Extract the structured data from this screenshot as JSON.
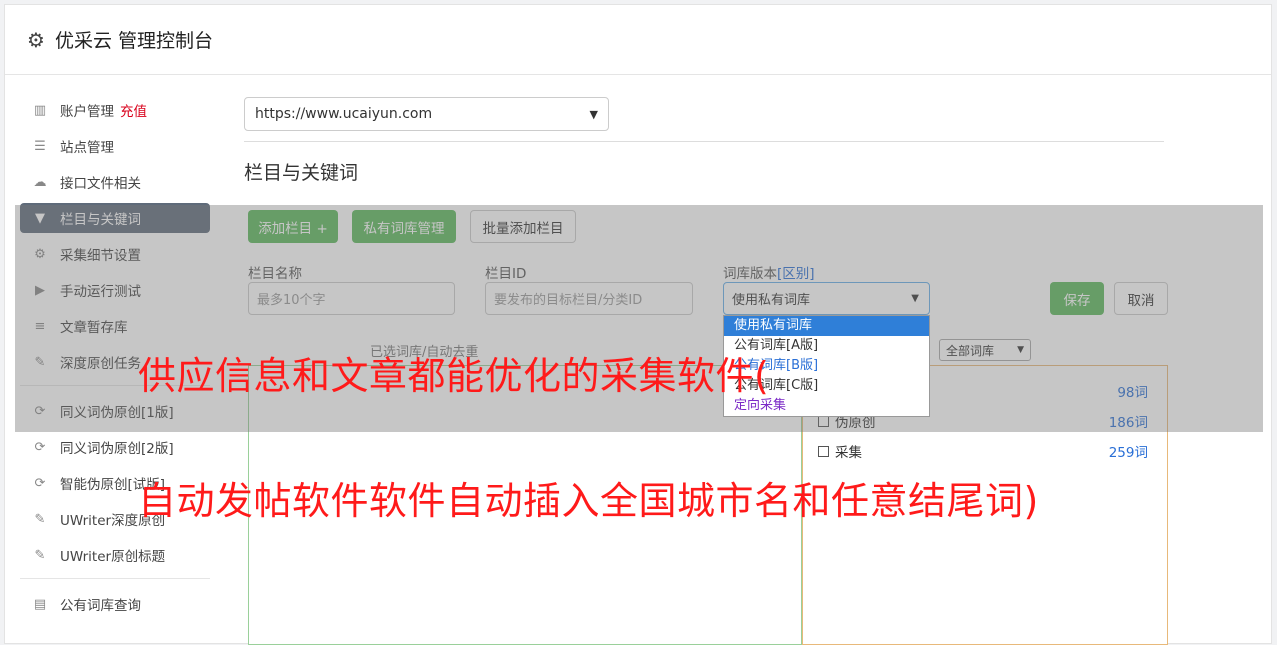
{
  "app": {
    "title": "优采云 管理控制台",
    "icon": "gear-icon"
  },
  "sidebar": {
    "items": [
      {
        "label": "账户管理",
        "icon": "bar-chart-icon",
        "extra": "充值"
      },
      {
        "label": "站点管理",
        "icon": "server-icon"
      },
      {
        "label": "接口文件相关",
        "icon": "cloud-upload-icon"
      },
      {
        "label": "栏目与关键词",
        "icon": "filter-icon",
        "active": true
      },
      {
        "label": "采集细节设置",
        "icon": "gears-icon"
      },
      {
        "label": "手动运行测试",
        "icon": "play-circle-icon"
      },
      {
        "label": "文章暂存库",
        "icon": "database-icon"
      },
      {
        "label": "深度原创任务",
        "icon": "edit-icon"
      },
      {
        "label": "同义词伪原创[1版]",
        "icon": "refresh-icon"
      },
      {
        "label": "同义词伪原创[2版]",
        "icon": "refresh-icon"
      },
      {
        "label": "智能伪原创[试版]",
        "icon": "refresh-icon"
      },
      {
        "label": "UWriter深度原创",
        "icon": "edit-icon"
      },
      {
        "label": "UWriter原创标题",
        "icon": "edit-icon"
      },
      {
        "label": "公有词库查询",
        "icon": "book-icon"
      }
    ]
  },
  "main": {
    "site_select": "https://www.ucaiyun.com",
    "section_title": "栏目与关键词",
    "buttons": {
      "add_column": "添加栏目 +",
      "private_lib": "私有词库管理",
      "batch_add": "批量添加栏目",
      "save": "保存",
      "cancel": "取消"
    },
    "form": {
      "name_label": "栏目名称",
      "name_placeholder": "最多10个字",
      "id_label": "栏目ID",
      "id_placeholder": "要发布的目标栏目/分类ID",
      "version_label": "词库版本",
      "version_link": "[区别]",
      "version_value": "使用私有词库",
      "version_options": [
        "使用私有词库",
        "公有词库[A版]",
        "公有词库[B版]",
        "公有词库[C版]",
        "定向采集"
      ]
    },
    "selected_hint": "已选词库/自动去重",
    "lib_filter": "全部词库",
    "lib_list": [
      {
        "name": "",
        "count": "98词"
      },
      {
        "name": "伪原创",
        "count": "186词"
      },
      {
        "name": "采集",
        "count": "259词"
      }
    ]
  },
  "banner": {
    "line1": "供应信息和文章都能优化的采集软件(",
    "line2": "自动发帖软件软件自动插入全国城市名和任意结尾词)"
  }
}
